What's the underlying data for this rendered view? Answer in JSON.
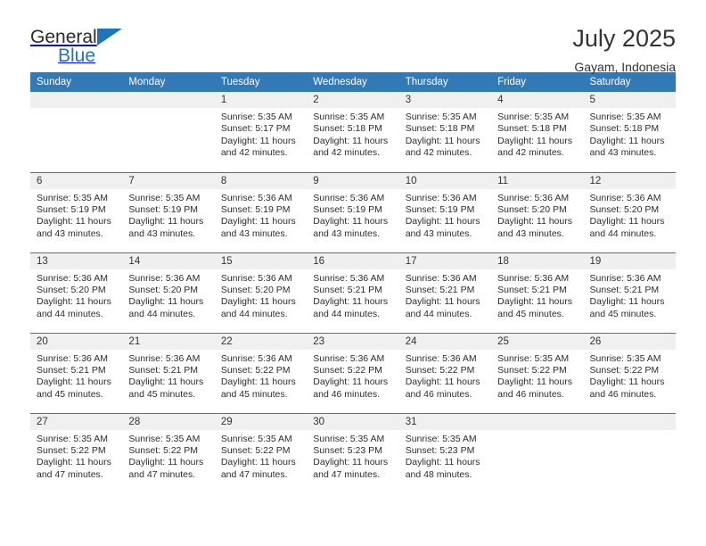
{
  "brand": {
    "name_top": "General",
    "name_bottom": "Blue",
    "triangle_color": "#1d76bc"
  },
  "header": {
    "title": "July 2025",
    "location": "Gayam, Indonesia"
  },
  "theme": {
    "header_blue": "#3279b7",
    "daynum_band": "#f0f0f0",
    "text": "#2d2d2d"
  },
  "labels": {
    "sunrise_prefix": "Sunrise:",
    "sunset_prefix": "Sunset:",
    "daylight_prefix": "Daylight:"
  },
  "weekday_headers": [
    "Sunday",
    "Monday",
    "Tuesday",
    "Wednesday",
    "Thursday",
    "Friday",
    "Saturday"
  ],
  "weeks": [
    [
      {
        "day": "",
        "empty": true,
        "sunrise": "",
        "sunset": "",
        "daylight_line1": "",
        "daylight_line2": ""
      },
      {
        "day": "",
        "empty": true,
        "sunrise": "",
        "sunset": "",
        "daylight_line1": "",
        "daylight_line2": ""
      },
      {
        "day": "1",
        "empty": false,
        "sunrise": "Sunrise: 5:35 AM",
        "sunset": "Sunset: 5:17 PM",
        "daylight_line1": "Daylight: 11 hours",
        "daylight_line2": "and 42 minutes."
      },
      {
        "day": "2",
        "empty": false,
        "sunrise": "Sunrise: 5:35 AM",
        "sunset": "Sunset: 5:18 PM",
        "daylight_line1": "Daylight: 11 hours",
        "daylight_line2": "and 42 minutes."
      },
      {
        "day": "3",
        "empty": false,
        "sunrise": "Sunrise: 5:35 AM",
        "sunset": "Sunset: 5:18 PM",
        "daylight_line1": "Daylight: 11 hours",
        "daylight_line2": "and 42 minutes."
      },
      {
        "day": "4",
        "empty": false,
        "sunrise": "Sunrise: 5:35 AM",
        "sunset": "Sunset: 5:18 PM",
        "daylight_line1": "Daylight: 11 hours",
        "daylight_line2": "and 42 minutes."
      },
      {
        "day": "5",
        "empty": false,
        "sunrise": "Sunrise: 5:35 AM",
        "sunset": "Sunset: 5:18 PM",
        "daylight_line1": "Daylight: 11 hours",
        "daylight_line2": "and 43 minutes."
      }
    ],
    [
      {
        "day": "6",
        "empty": false,
        "sunrise": "Sunrise: 5:35 AM",
        "sunset": "Sunset: 5:19 PM",
        "daylight_line1": "Daylight: 11 hours",
        "daylight_line2": "and 43 minutes."
      },
      {
        "day": "7",
        "empty": false,
        "sunrise": "Sunrise: 5:35 AM",
        "sunset": "Sunset: 5:19 PM",
        "daylight_line1": "Daylight: 11 hours",
        "daylight_line2": "and 43 minutes."
      },
      {
        "day": "8",
        "empty": false,
        "sunrise": "Sunrise: 5:36 AM",
        "sunset": "Sunset: 5:19 PM",
        "daylight_line1": "Daylight: 11 hours",
        "daylight_line2": "and 43 minutes."
      },
      {
        "day": "9",
        "empty": false,
        "sunrise": "Sunrise: 5:36 AM",
        "sunset": "Sunset: 5:19 PM",
        "daylight_line1": "Daylight: 11 hours",
        "daylight_line2": "and 43 minutes."
      },
      {
        "day": "10",
        "empty": false,
        "sunrise": "Sunrise: 5:36 AM",
        "sunset": "Sunset: 5:19 PM",
        "daylight_line1": "Daylight: 11 hours",
        "daylight_line2": "and 43 minutes."
      },
      {
        "day": "11",
        "empty": false,
        "sunrise": "Sunrise: 5:36 AM",
        "sunset": "Sunset: 5:20 PM",
        "daylight_line1": "Daylight: 11 hours",
        "daylight_line2": "and 43 minutes."
      },
      {
        "day": "12",
        "empty": false,
        "sunrise": "Sunrise: 5:36 AM",
        "sunset": "Sunset: 5:20 PM",
        "daylight_line1": "Daylight: 11 hours",
        "daylight_line2": "and 44 minutes."
      }
    ],
    [
      {
        "day": "13",
        "empty": false,
        "sunrise": "Sunrise: 5:36 AM",
        "sunset": "Sunset: 5:20 PM",
        "daylight_line1": "Daylight: 11 hours",
        "daylight_line2": "and 44 minutes."
      },
      {
        "day": "14",
        "empty": false,
        "sunrise": "Sunrise: 5:36 AM",
        "sunset": "Sunset: 5:20 PM",
        "daylight_line1": "Daylight: 11 hours",
        "daylight_line2": "and 44 minutes."
      },
      {
        "day": "15",
        "empty": false,
        "sunrise": "Sunrise: 5:36 AM",
        "sunset": "Sunset: 5:20 PM",
        "daylight_line1": "Daylight: 11 hours",
        "daylight_line2": "and 44 minutes."
      },
      {
        "day": "16",
        "empty": false,
        "sunrise": "Sunrise: 5:36 AM",
        "sunset": "Sunset: 5:21 PM",
        "daylight_line1": "Daylight: 11 hours",
        "daylight_line2": "and 44 minutes."
      },
      {
        "day": "17",
        "empty": false,
        "sunrise": "Sunrise: 5:36 AM",
        "sunset": "Sunset: 5:21 PM",
        "daylight_line1": "Daylight: 11 hours",
        "daylight_line2": "and 44 minutes."
      },
      {
        "day": "18",
        "empty": false,
        "sunrise": "Sunrise: 5:36 AM",
        "sunset": "Sunset: 5:21 PM",
        "daylight_line1": "Daylight: 11 hours",
        "daylight_line2": "and 45 minutes."
      },
      {
        "day": "19",
        "empty": false,
        "sunrise": "Sunrise: 5:36 AM",
        "sunset": "Sunset: 5:21 PM",
        "daylight_line1": "Daylight: 11 hours",
        "daylight_line2": "and 45 minutes."
      }
    ],
    [
      {
        "day": "20",
        "empty": false,
        "sunrise": "Sunrise: 5:36 AM",
        "sunset": "Sunset: 5:21 PM",
        "daylight_line1": "Daylight: 11 hours",
        "daylight_line2": "and 45 minutes."
      },
      {
        "day": "21",
        "empty": false,
        "sunrise": "Sunrise: 5:36 AM",
        "sunset": "Sunset: 5:21 PM",
        "daylight_line1": "Daylight: 11 hours",
        "daylight_line2": "and 45 minutes."
      },
      {
        "day": "22",
        "empty": false,
        "sunrise": "Sunrise: 5:36 AM",
        "sunset": "Sunset: 5:22 PM",
        "daylight_line1": "Daylight: 11 hours",
        "daylight_line2": "and 45 minutes."
      },
      {
        "day": "23",
        "empty": false,
        "sunrise": "Sunrise: 5:36 AM",
        "sunset": "Sunset: 5:22 PM",
        "daylight_line1": "Daylight: 11 hours",
        "daylight_line2": "and 46 minutes."
      },
      {
        "day": "24",
        "empty": false,
        "sunrise": "Sunrise: 5:36 AM",
        "sunset": "Sunset: 5:22 PM",
        "daylight_line1": "Daylight: 11 hours",
        "daylight_line2": "and 46 minutes."
      },
      {
        "day": "25",
        "empty": false,
        "sunrise": "Sunrise: 5:35 AM",
        "sunset": "Sunset: 5:22 PM",
        "daylight_line1": "Daylight: 11 hours",
        "daylight_line2": "and 46 minutes."
      },
      {
        "day": "26",
        "empty": false,
        "sunrise": "Sunrise: 5:35 AM",
        "sunset": "Sunset: 5:22 PM",
        "daylight_line1": "Daylight: 11 hours",
        "daylight_line2": "and 46 minutes."
      }
    ],
    [
      {
        "day": "27",
        "empty": false,
        "sunrise": "Sunrise: 5:35 AM",
        "sunset": "Sunset: 5:22 PM",
        "daylight_line1": "Daylight: 11 hours",
        "daylight_line2": "and 47 minutes."
      },
      {
        "day": "28",
        "empty": false,
        "sunrise": "Sunrise: 5:35 AM",
        "sunset": "Sunset: 5:22 PM",
        "daylight_line1": "Daylight: 11 hours",
        "daylight_line2": "and 47 minutes."
      },
      {
        "day": "29",
        "empty": false,
        "sunrise": "Sunrise: 5:35 AM",
        "sunset": "Sunset: 5:22 PM",
        "daylight_line1": "Daylight: 11 hours",
        "daylight_line2": "and 47 minutes."
      },
      {
        "day": "30",
        "empty": false,
        "sunrise": "Sunrise: 5:35 AM",
        "sunset": "Sunset: 5:23 PM",
        "daylight_line1": "Daylight: 11 hours",
        "daylight_line2": "and 47 minutes."
      },
      {
        "day": "31",
        "empty": false,
        "sunrise": "Sunrise: 5:35 AM",
        "sunset": "Sunset: 5:23 PM",
        "daylight_line1": "Daylight: 11 hours",
        "daylight_line2": "and 48 minutes."
      },
      {
        "day": "",
        "empty": true,
        "sunrise": "",
        "sunset": "",
        "daylight_line1": "",
        "daylight_line2": ""
      },
      {
        "day": "",
        "empty": true,
        "sunrise": "",
        "sunset": "",
        "daylight_line1": "",
        "daylight_line2": ""
      }
    ]
  ]
}
